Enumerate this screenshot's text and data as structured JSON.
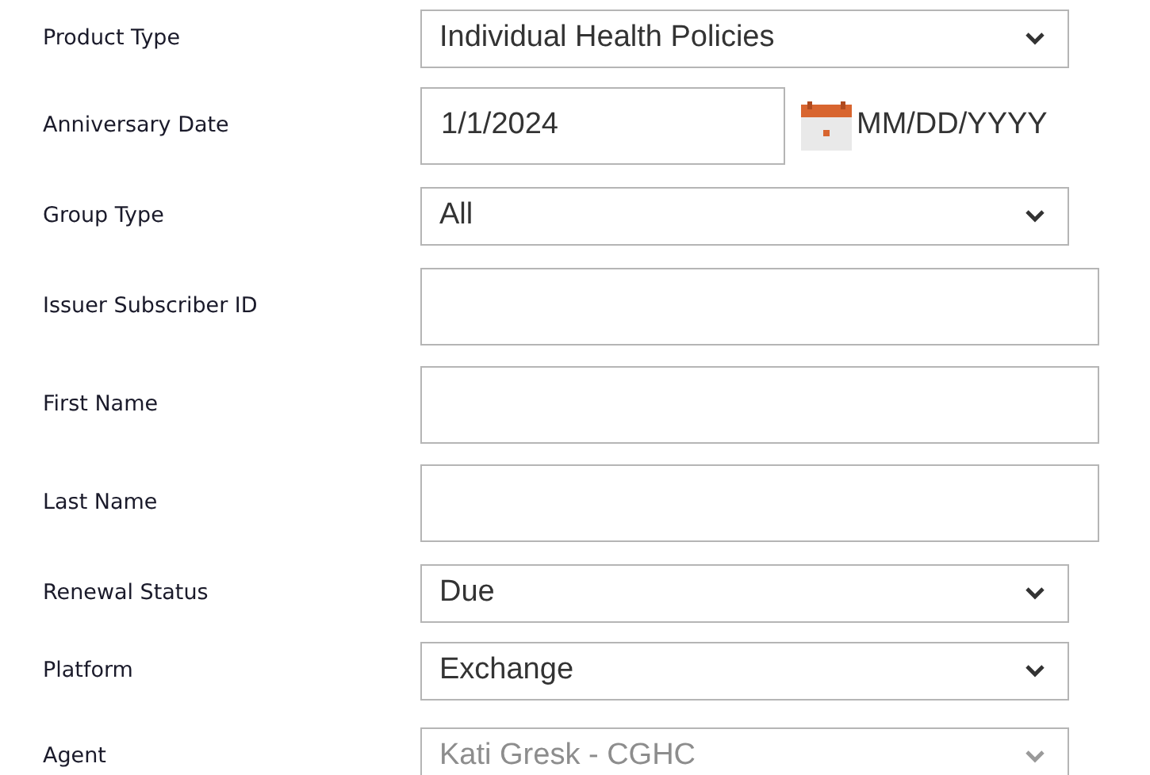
{
  "fields": [
    {
      "kind": "select",
      "label": "Product Type",
      "value": "Individual Health Policies",
      "disabled": false
    },
    {
      "kind": "date",
      "label": "Anniversary Date",
      "value": "1/1/2024",
      "format_hint": "MM/DD/YYYY"
    },
    {
      "kind": "select",
      "label": "Group Type",
      "value": "All",
      "disabled": false
    },
    {
      "kind": "text",
      "label": "Issuer Subscriber ID"
    },
    {
      "kind": "text",
      "label": "First Name"
    },
    {
      "kind": "text",
      "label": "Last Name"
    },
    {
      "kind": "select",
      "label": "Renewal Status",
      "value": "Due",
      "disabled": false
    },
    {
      "kind": "select",
      "label": "Platform",
      "value": "Exchange",
      "disabled": false
    },
    {
      "kind": "select",
      "label": "Agent",
      "value": "Kati Gresk - CGHC",
      "disabled": true
    }
  ]
}
